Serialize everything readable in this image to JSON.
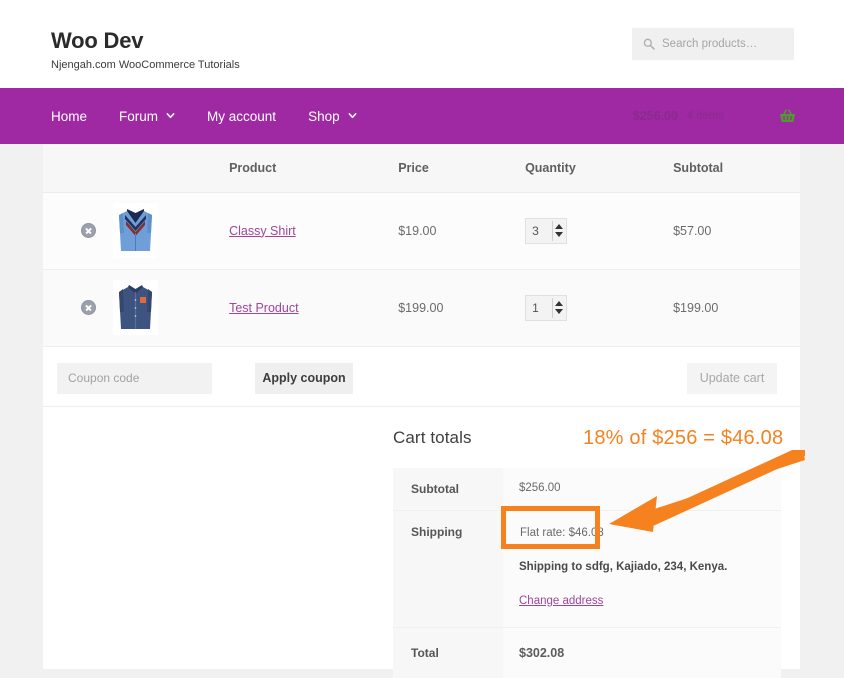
{
  "header": {
    "brand_title": "Woo Dev",
    "brand_tagline": "Njengah.com WooCommerce Tutorials",
    "search_placeholder": "Search products…",
    "search_value": ""
  },
  "nav": {
    "items": [
      {
        "label": "Home",
        "has_caret": false
      },
      {
        "label": "Forum",
        "has_caret": true
      },
      {
        "label": "My account",
        "has_caret": false
      },
      {
        "label": "Shop",
        "has_caret": true
      }
    ],
    "cart_total": "$256.00",
    "cart_count": "4 items",
    "background_color": "#9f29a3"
  },
  "cart_table": {
    "columns": [
      "",
      "",
      "Product",
      "Price",
      "Quantity",
      "Subtotal"
    ],
    "rows": [
      {
        "remove_label": "×",
        "product_name": "Classy Shirt",
        "price": "$19.00",
        "quantity": "3",
        "subtotal": "$57.00",
        "thumb_alt": "classy-shirt-thumbnail"
      },
      {
        "remove_label": "×",
        "product_name": "Test Product",
        "price": "$199.00",
        "quantity": "1",
        "subtotal": "$199.00",
        "thumb_alt": "test-product-thumbnail"
      }
    ]
  },
  "coupon": {
    "placeholder": "Coupon code",
    "value": "",
    "apply_label": "Apply coupon",
    "update_label": "Update cart"
  },
  "totals": {
    "heading": "Cart totals",
    "subtotal_label": "Subtotal",
    "subtotal_value": "$256.00",
    "shipping_label": "Shipping",
    "shipping_rate": "Flat rate: $46.08",
    "shipping_to": "Shipping to sdfg, Kajiado, 234, Kenya.",
    "change_address_label": "Change address",
    "total_label": "Total",
    "total_value": "$302.08"
  },
  "annotation": {
    "text": "18% of $256 = $46.08",
    "color": "#f5821f"
  }
}
